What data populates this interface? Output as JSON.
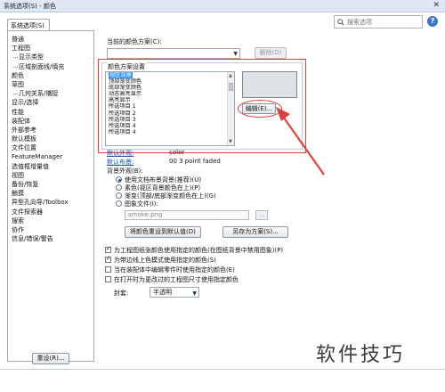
{
  "window": {
    "title": "系统选项(S) - 颜色",
    "close_glyph": "✕"
  },
  "tab": {
    "label": "系统选项(S)"
  },
  "search": {
    "placeholder": "搜索选项"
  },
  "help": {
    "glyph": "?"
  },
  "tree": {
    "items": [
      {
        "label": "普通",
        "child": false,
        "selected": false
      },
      {
        "label": "工程图",
        "child": false,
        "selected": false
      },
      {
        "label": "显示类型",
        "child": true,
        "selected": false
      },
      {
        "label": "区域剖面线/填充",
        "child": true,
        "selected": false
      },
      {
        "label": "颜色",
        "child": false,
        "selected": false
      },
      {
        "label": "草图",
        "child": false,
        "selected": false
      },
      {
        "label": "几何关系/捕捉",
        "child": true,
        "selected": false
      },
      {
        "label": "显示/选择",
        "child": false,
        "selected": false
      },
      {
        "label": "性能",
        "child": false,
        "selected": false
      },
      {
        "label": "装配体",
        "child": false,
        "selected": false
      },
      {
        "label": "外部参考",
        "child": false,
        "selected": false
      },
      {
        "label": "默认模板",
        "child": false,
        "selected": false
      },
      {
        "label": "文件位置",
        "child": false,
        "selected": false
      },
      {
        "label": "FeatureManager",
        "child": false,
        "selected": false
      },
      {
        "label": "选值框增量值",
        "child": false,
        "selected": false
      },
      {
        "label": "视图",
        "child": false,
        "selected": false
      },
      {
        "label": "备份/恢复",
        "child": false,
        "selected": false
      },
      {
        "label": "触摸",
        "child": false,
        "selected": false
      },
      {
        "label": "异型孔向导/Toolbox",
        "child": false,
        "selected": false
      },
      {
        "label": "文件探索器",
        "child": false,
        "selected": false
      },
      {
        "label": "搜索",
        "child": false,
        "selected": false
      },
      {
        "label": "协作",
        "child": false,
        "selected": false
      },
      {
        "label": "信息/错误/警告",
        "child": false,
        "selected": false
      }
    ]
  },
  "reset_button": {
    "label": "重设(R)..."
  },
  "scheme": {
    "label": "当前的颜色方案(C):",
    "value": "",
    "delete_label": "删除(D)"
  },
  "color_group": {
    "title": "颜色方案设置",
    "items": [
      {
        "label": "视区背景",
        "selected": true
      },
      {
        "label": "顶部渐变颜色",
        "selected": false
      },
      {
        "label": "底部渐变颜色",
        "selected": false
      },
      {
        "label": "动态高亮显示",
        "selected": false
      },
      {
        "label": "高亮显示",
        "selected": false
      },
      {
        "label": "所选项目 1",
        "selected": false
      },
      {
        "label": "所选项目 2",
        "selected": false
      },
      {
        "label": "所选项目 3",
        "selected": false
      },
      {
        "label": "所选项目 4",
        "selected": false
      },
      {
        "label": "所选项目 4",
        "selected": false
      }
    ],
    "swatch_color": "#dfe3e8",
    "edit_label": "编辑(E)..."
  },
  "defaults": {
    "appearance_label": "默认外观:",
    "appearance_value": "color",
    "scene_label": "默认布景:",
    "scene_value": "00 3 point faded"
  },
  "background": {
    "label": "背景外观(B):",
    "options": [
      {
        "label": "使用文档布景背景(推荐)(U)",
        "checked": true
      },
      {
        "label": "素色(视区背景颜色在上)(P)",
        "checked": false
      },
      {
        "label": "渐变(顶部/底部渐变颜色在上)(G)",
        "checked": false
      },
      {
        "label": "图象文件(I):",
        "checked": false
      }
    ],
    "image_path": "smoke.png",
    "browse_label": "..."
  },
  "buttons": {
    "save_bg_label": "将颜色重设到默认值(D)",
    "save_as_label": "另存为方案(S)..."
  },
  "checks": [
    {
      "label": "为工程图纸张颜色使用指定的颜色(在图纸背景中禁用图象)(P)",
      "checked": true
    },
    {
      "label": "为带边线上色模式使用指定的颜色(S)",
      "checked": true
    },
    {
      "label": "当在装配体中编辑零件时使用指定的颜色(E)",
      "checked": false
    },
    {
      "label": "在打开时为更改过的工程图尺寸使用指定颜色",
      "checked": false
    }
  ],
  "envelope": {
    "label": "封套:",
    "value": "半透明",
    "arrow": "▼"
  },
  "watermark": {
    "text": "软件技巧"
  },
  "colors": {
    "accent": "#3399ff",
    "highlight_red": "#e0413a",
    "link_blue": "#1a4fa8"
  }
}
